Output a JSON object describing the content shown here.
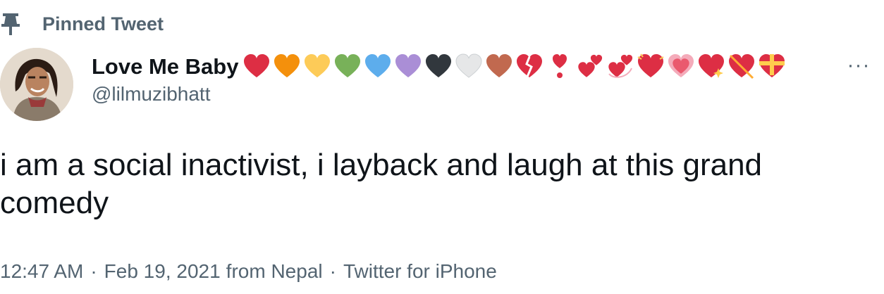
{
  "pinned": {
    "label": "Pinned Tweet",
    "icon": "pin-icon"
  },
  "author": {
    "display_name": "Love Me Baby",
    "handle": "@lilmuzibhatt",
    "avatar": "avatar",
    "name_emojis": [
      {
        "name": "red-heart",
        "color": "#dd2e44"
      },
      {
        "name": "orange-heart",
        "color": "#f4900c"
      },
      {
        "name": "yellow-heart",
        "color": "#fdcb58"
      },
      {
        "name": "green-heart",
        "color": "#78b159"
      },
      {
        "name": "blue-heart",
        "color": "#5dadec"
      },
      {
        "name": "purple-heart",
        "color": "#aa8ed6"
      },
      {
        "name": "black-heart",
        "color": "#31373d"
      },
      {
        "name": "white-heart",
        "color": "#e6e7e8"
      },
      {
        "name": "brown-heart",
        "color": "#c1694f"
      },
      {
        "name": "broken-heart",
        "color": "#dd2e44"
      },
      {
        "name": "heart-exclamation",
        "color": "#dd2e44"
      },
      {
        "name": "two-hearts",
        "color": "#dd2e44"
      },
      {
        "name": "revolving-hearts",
        "color": "#dd2e44"
      },
      {
        "name": "beating-heart",
        "color": "#dd2e44"
      },
      {
        "name": "growing-heart",
        "color": "#f4abba"
      },
      {
        "name": "sparkling-heart",
        "color": "#dd2e44"
      },
      {
        "name": "heart-with-arrow",
        "color": "#dd2e44"
      },
      {
        "name": "heart-with-ribbon",
        "color": "#dd2e44"
      }
    ]
  },
  "more_button": {
    "icon": "more-icon",
    "label": "···"
  },
  "tweet": {
    "text": "i am a social inactivist, i layback and laugh at this grand comedy",
    "time": "12:47 AM",
    "separator": "·",
    "date": "Feb 19, 2021",
    "location": "from Nepal",
    "source": "Twitter for iPhone"
  }
}
